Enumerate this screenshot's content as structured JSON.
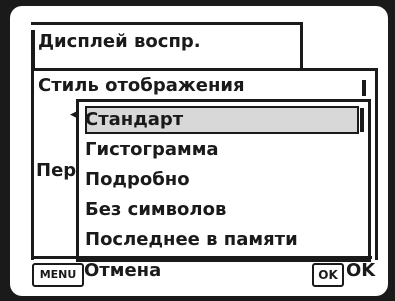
{
  "tab": {
    "title": "Дисплей воспр."
  },
  "setting": {
    "label": "Стиль отображения"
  },
  "hidden_row": {
    "label_fragment": "Пер"
  },
  "dropdown": {
    "options": [
      {
        "label": "Стандарт",
        "selected": true
      },
      {
        "label": "Гистограмма",
        "selected": false
      },
      {
        "label": "Подробно",
        "selected": false
      },
      {
        "label": "Без символов",
        "selected": false
      },
      {
        "label": "Последнее в памяти",
        "selected": false
      }
    ]
  },
  "footer": {
    "menu_key": "MENU",
    "menu_action": "Отмена",
    "ok_key": "OK",
    "ok_action": "OK"
  }
}
